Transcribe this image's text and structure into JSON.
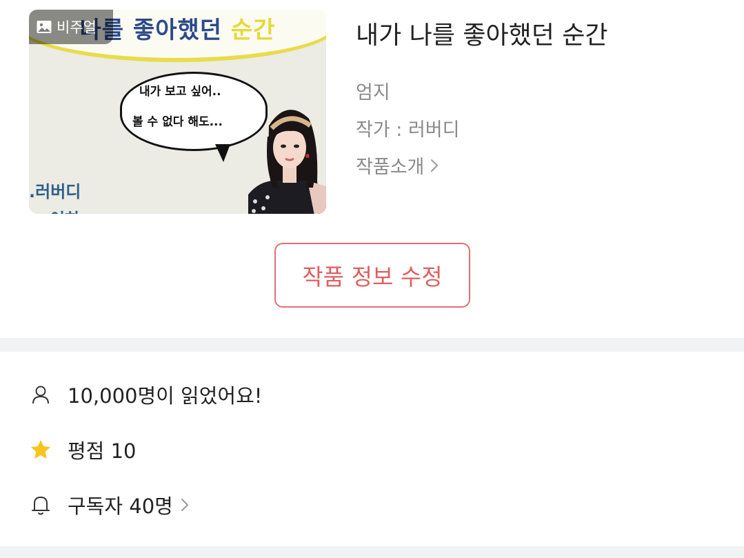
{
  "cover": {
    "badge_label": "비주얼",
    "banner_text_main": "나를 좋아했던 ",
    "banner_text_accent": "순간",
    "bubble_line1": "내가 보고 싶어..",
    "bubble_line2": "볼 수 없다 해도...",
    "cover_author_text": ".러버디",
    "cover_author_text2": "이하"
  },
  "work": {
    "title": "내가 나를 좋아했던 순간",
    "genre": "엄지",
    "author": "작가 : 러버디",
    "intro_link": "작품소개"
  },
  "edit_button_label": "작품 정보 수정",
  "stats": {
    "views": "10,000명이 읽었어요!",
    "rating": "평점 10",
    "subscribers": "구독자 40명"
  },
  "colors": {
    "accent": "#df5f5f",
    "divider": "#f1f2f3",
    "star": "#f7c51e",
    "muted_text": "#8a8a8a"
  },
  "icons": {
    "views": "person-icon",
    "rating": "star-icon",
    "subscribers": "bell-icon",
    "badge": "image-icon",
    "chevron": "chevron-right-icon"
  }
}
